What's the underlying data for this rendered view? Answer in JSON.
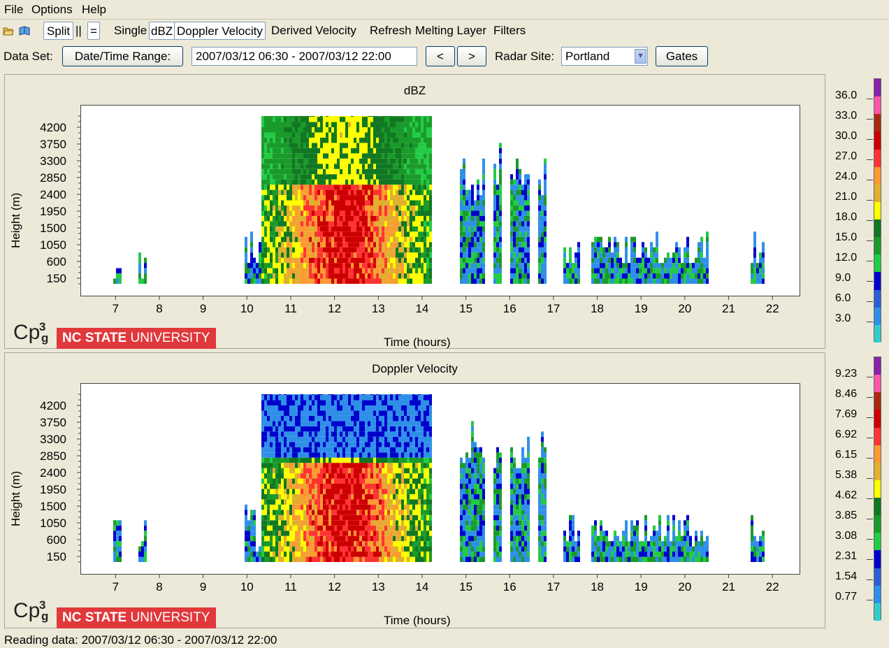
{
  "menu": [
    "File",
    "Options",
    "Help"
  ],
  "toolbar": {
    "split": "Split",
    "parallel": "||",
    "equal": "=",
    "single": "Single",
    "dbz": "dBZ",
    "doppler": "Doppler Velocity",
    "derived": "Derived Velocity",
    "refresh": "Refresh",
    "melting": "Melting Layer",
    "filters": "Filters"
  },
  "datarow": {
    "dataset_label": "Data Set:",
    "datetime_button": "Date/Time Range:",
    "range_value": "2007/03/12 06:30 - 2007/03/12 22:00",
    "prev": "<",
    "next": ">",
    "radar_label": "Radar Site:",
    "radar_value": "Portland",
    "gates": "Gates"
  },
  "logo": {
    "cp3g": "CP3g",
    "ncsu_bold": "NC STATE",
    "ncsu_rest": " UNIVERSITY"
  },
  "status": "Reading data: 2007/03/12 06:30 - 2007/03/12 22:00",
  "colors": {
    "scale": [
      "#33cccc",
      "#2f8fe8",
      "#2b5fd8",
      "#0000cc",
      "#22cc44",
      "#1a9a2a",
      "#117722",
      "#ffff00",
      "#e0b030",
      "#ff9933",
      "#ff3333",
      "#cc0000",
      "#aa2a10",
      "#ff55aa",
      "#8822aa"
    ]
  },
  "chart_data": [
    {
      "type": "heatmap",
      "title": "dBZ",
      "xlabel": "Time (hours)",
      "ylabel": "Height (m)",
      "x_ticks": [
        "7",
        "8",
        "9",
        "10",
        "11",
        "12",
        "13",
        "14",
        "15",
        "16",
        "17",
        "18",
        "19",
        "20",
        "21",
        "22"
      ],
      "y_ticks": [
        "150",
        "600",
        "1050",
        "1500",
        "1950",
        "2400",
        "2850",
        "3300",
        "3750",
        "4200"
      ],
      "xlim": [
        6.5,
        22.3
      ],
      "ylim": [
        0,
        4500
      ],
      "colorbar_labels": [
        "36.0",
        "33.0",
        "30.0",
        "27.0",
        "24.0",
        "21.0",
        "18.0",
        "15.0",
        "12.0",
        "9.0",
        "6.0",
        "3.0"
      ]
    },
    {
      "type": "heatmap",
      "title": "Doppler Velocity",
      "xlabel": "Time (hours)",
      "ylabel": "Height (m)",
      "x_ticks": [
        "7",
        "8",
        "9",
        "10",
        "11",
        "12",
        "13",
        "14",
        "15",
        "16",
        "17",
        "18",
        "19",
        "20",
        "21",
        "22"
      ],
      "y_ticks": [
        "150",
        "600",
        "1050",
        "1500",
        "1950",
        "2400",
        "2850",
        "3300",
        "3750",
        "4200"
      ],
      "xlim": [
        6.5,
        22.3
      ],
      "ylim": [
        0,
        4500
      ],
      "colorbar_labels": [
        "9.23",
        "8.46",
        "7.69",
        "6.92",
        "6.15",
        "5.38",
        "4.62",
        "3.85",
        "3.08",
        "2.31",
        "1.54",
        "0.77"
      ]
    }
  ]
}
